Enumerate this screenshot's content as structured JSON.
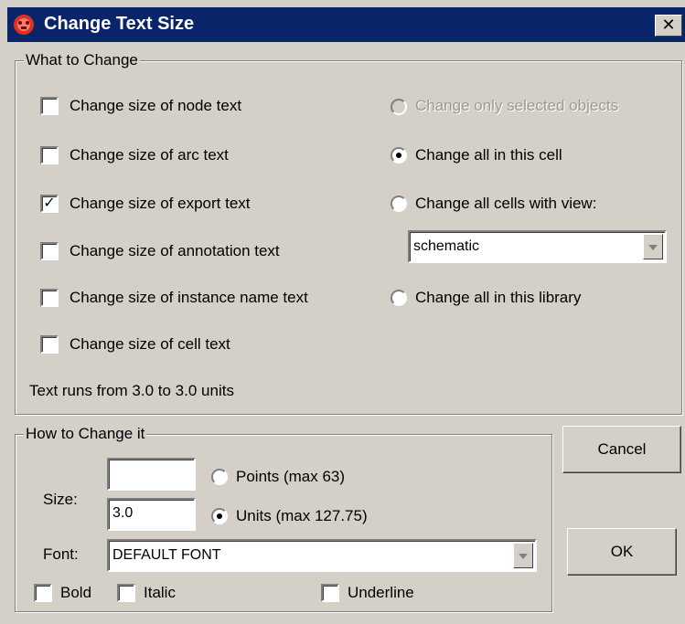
{
  "window": {
    "title": "Change Text Size",
    "close_glyph": "✕",
    "icon": "app-red-icon"
  },
  "what_to_change": {
    "legend": "What to Change",
    "checkboxes": [
      {
        "label": "Change size of node text",
        "checked": false
      },
      {
        "label": "Change size of arc text",
        "checked": false
      },
      {
        "label": "Change size of export text",
        "checked": true
      },
      {
        "label": "Change size of annotation text",
        "checked": false
      },
      {
        "label": "Change size of instance name text",
        "checked": false
      },
      {
        "label": "Change size of cell text",
        "checked": false
      }
    ],
    "radios": [
      {
        "label": "Change only selected objects",
        "selected": false,
        "disabled": true
      },
      {
        "label": "Change all in this cell",
        "selected": true,
        "disabled": false
      },
      {
        "label": "Change all cells with view:",
        "selected": false,
        "disabled": false
      },
      {
        "label": "Change all in this library",
        "selected": false,
        "disabled": false
      }
    ],
    "view_select": "schematic",
    "range_text": "Text runs from 3.0 to 3.0 units"
  },
  "how_to_change": {
    "legend": "How to Change it",
    "size_label": "Size:",
    "points_value": "",
    "points_label": "Points (max 63)",
    "points_selected": false,
    "units_value": "3.0",
    "units_label": "Units (max 127.75)",
    "units_selected": true,
    "font_label": "Font:",
    "font_value": "DEFAULT FONT",
    "bold_label": "Bold",
    "italic_label": "Italic",
    "underline_label": "Underline"
  },
  "buttons": {
    "cancel": "Cancel",
    "ok": "OK"
  },
  "check_glyph": "✓"
}
